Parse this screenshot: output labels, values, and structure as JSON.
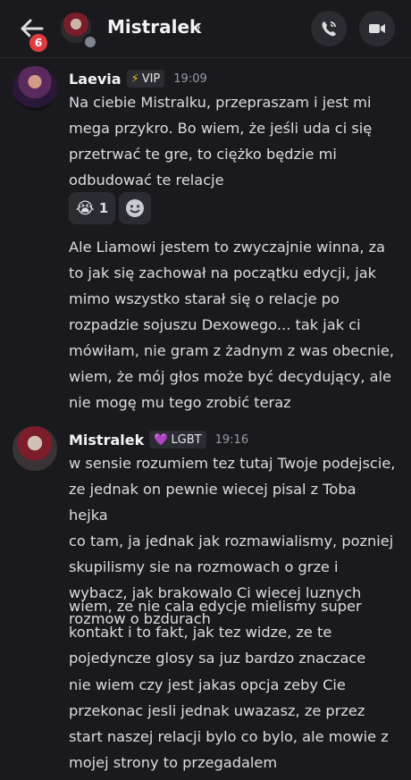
{
  "header": {
    "unread_count": "6",
    "channel_name": "Mistralek",
    "chevron": "›",
    "back_icon": "arrow-left-icon",
    "call_icon": "phone-call-icon",
    "video_icon": "video-camera-icon",
    "status": "offline"
  },
  "messages": [
    {
      "author": "Laevia",
      "tag": {
        "icon": "⚡",
        "label": "VIP"
      },
      "time": "19:09",
      "paragraph1": "Na ciebie Mistralku, przepraszam i jest mi\nmega przykro. Bo wiem, że jeśli uda ci się\nprzetrwać te gre, to ciężko będzie mi\nodbudować te relacje",
      "reaction": {
        "emoji": "😭",
        "count": "1"
      },
      "paragraph2": "Ale Liamowi jestem to zwyczajnie winna, za\nto jak się zachował na początku edycji, jak\nmimo wszystko starał się o relacje po\nrozpadzie sojuszu Dexowego... tak jak ci\nmówiłam, nie gram z żadnym z was obecnie,\nwiem, że mój głos może być decydujący, ale\nnie mogę mu tego zrobić teraz"
    },
    {
      "author": "Mistralek",
      "tag": {
        "icon": "💜",
        "label": "LGBT"
      },
      "time": "19:16",
      "paragraph1": "w sensie rozumiem tez tutaj Twoje podejscie,\nze jednak on pewnie wiecej pisal z Toba hejka\nco tam, ja jednak jak rozmawialismy, pozniej\nskupilismy sie na rozmowach o grze i\nwybacz, jak brakowalo Ci wiecej luznych\nrozmow o bzdurach",
      "paragraph2": "wiem, ze nie cala edycje mielismy super\nkontakt i to fakt, jak tez widze, ze te\npojedyncze glosy sa juz bardzo znaczace",
      "paragraph3": "nie wiem czy jest jakas opcja zeby Cie\nprzekonac jesli jednak uwazasz, ze przez\nstart naszej relacji bylo co bylo, ale mowie z\nmojej strony to przegadalem"
    }
  ]
}
